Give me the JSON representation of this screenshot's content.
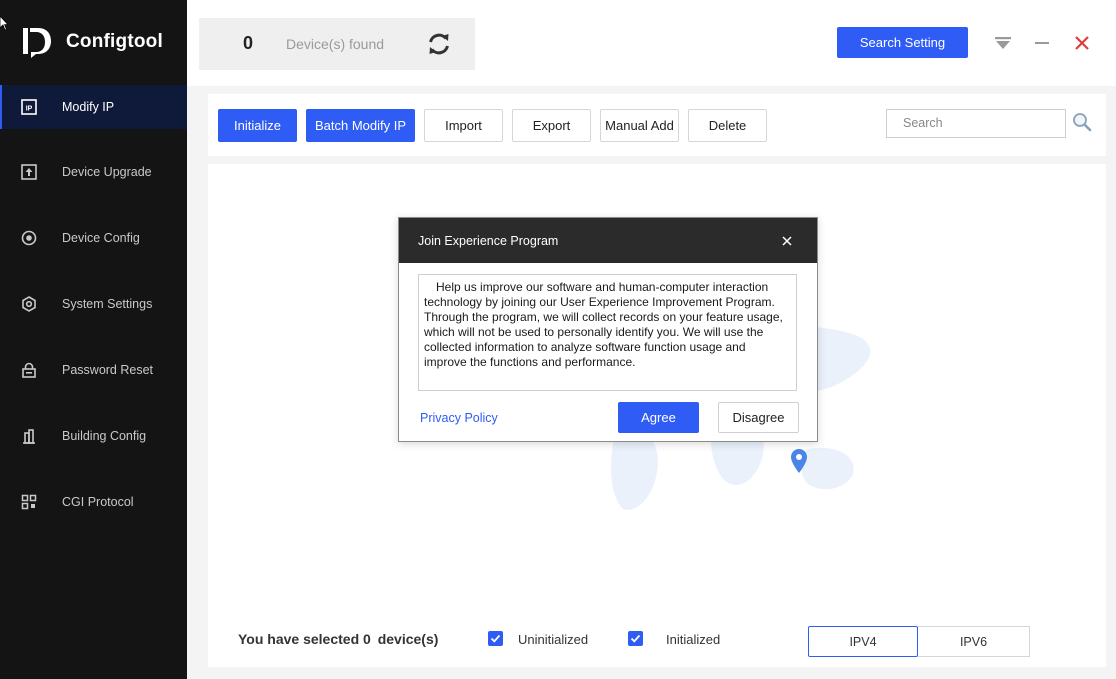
{
  "app": {
    "name": "Configtool",
    "logo_icon": "configtool-logo-icon"
  },
  "sidebar": {
    "items": [
      {
        "label": "Modify IP",
        "icon": "ip-icon",
        "active": true
      },
      {
        "label": "Device Upgrade",
        "icon": "upgrade-icon",
        "active": false
      },
      {
        "label": "Device Config",
        "icon": "config-icon",
        "active": false
      },
      {
        "label": "System Settings",
        "icon": "settings-icon",
        "active": false
      },
      {
        "label": "Password Reset",
        "icon": "lock-icon",
        "active": false
      },
      {
        "label": "Building Config",
        "icon": "building-icon",
        "active": false
      },
      {
        "label": "CGI Protocol",
        "icon": "grid-icon",
        "active": false
      }
    ]
  },
  "header": {
    "device_count": "0",
    "device_found_label": "Device(s) found",
    "search_setting_label": "Search Setting"
  },
  "toolbar": {
    "buttons": [
      {
        "label": "Initialize",
        "primary": true
      },
      {
        "label": "Batch Modify IP",
        "primary": true
      },
      {
        "label": "Import",
        "primary": false
      },
      {
        "label": "Export",
        "primary": false
      },
      {
        "label": "Manual Add",
        "primary": false
      },
      {
        "label": "Delete",
        "primary": false
      }
    ],
    "search_placeholder": "Search"
  },
  "footer": {
    "selected_prefix": "You have selected",
    "selected_count": "0",
    "selected_suffix": "device(s)",
    "filters": [
      {
        "label": "Uninitialized",
        "checked": true
      },
      {
        "label": "Initialized",
        "checked": true
      }
    ],
    "ip_versions": [
      "IPV4",
      "IPV6"
    ],
    "selected_ip_version": "IPV4"
  },
  "dialog": {
    "title": "Join Experience Program",
    "body": "Help us improve our software and human-computer interaction technology by joining our User Experience Improvement Program. Through the program, we will collect records on your feature usage, which will not be used to personally identify you. We will use the collected information to analyze software function usage and improve the functions and performance.",
    "privacy_link": "Privacy Policy",
    "agree_label": "Agree",
    "disagree_label": "Disagree"
  },
  "colors": {
    "accent": "#2f5cf5",
    "sidebar_bg": "#141414",
    "close_red": "#e23b3b"
  }
}
